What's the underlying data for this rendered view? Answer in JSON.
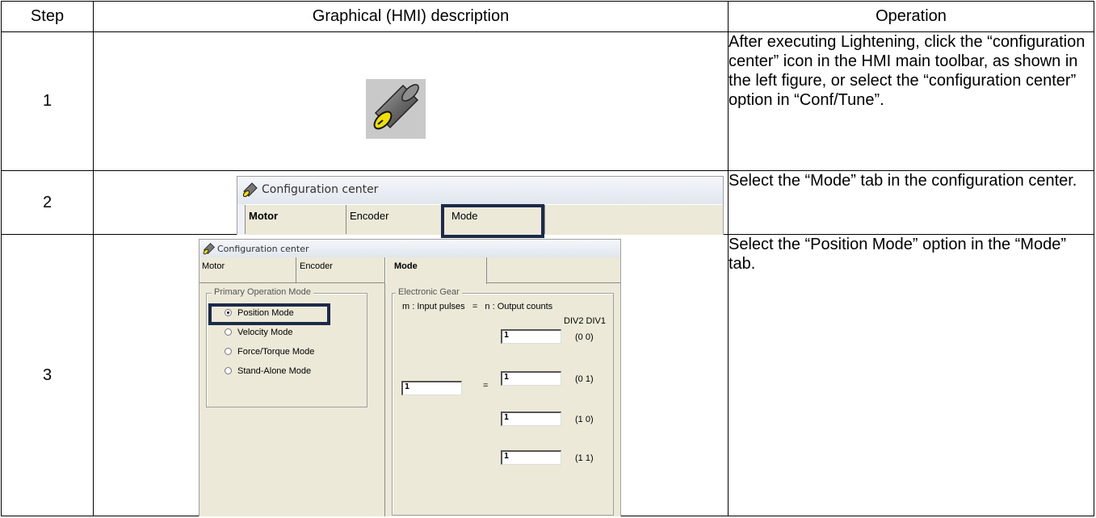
{
  "header": {
    "step": "Step",
    "graphical": "Graphical (HMI) description",
    "operation": "Operation"
  },
  "rows": [
    {
      "step": "1",
      "operation": "After executing Lightening, click the “configuration center” icon in the HMI main toolbar, as shown in the left figure, or select the “configuration center” option in “Conf/Tune”."
    },
    {
      "step": "2",
      "operation": "Select the “Mode” tab in the configuration center."
    },
    {
      "step": "3",
      "operation": "Select the “Position Mode” option in the “Mode” tab."
    }
  ],
  "window": {
    "title": "Configuration center",
    "tabs": [
      "Motor",
      "Encoder",
      "Mode"
    ],
    "primary_group": "Primary Operation Mode",
    "modes": [
      "Position Mode",
      "Velocity Mode",
      "Force/Torque Mode",
      "Stand-Alone Mode"
    ],
    "selected_mode": "Position Mode",
    "gear_group": "Electronic Gear",
    "gear_formula": "m : Input pulses   =   n : Output counts",
    "div_header": "DIV2 DIV1",
    "m_value": "1",
    "equals": "=",
    "n_values": [
      "1",
      "1",
      "1",
      "1"
    ],
    "div_codes": [
      "(0 0)",
      "(0 1)",
      "(1 0)",
      "(1 1)"
    ]
  },
  "colors": {
    "highlight": "#1c2a4a",
    "dialog_bg": "#ece9d8",
    "icon_bg": "#c9c9c9",
    "icon_dial": "#f0e000"
  }
}
